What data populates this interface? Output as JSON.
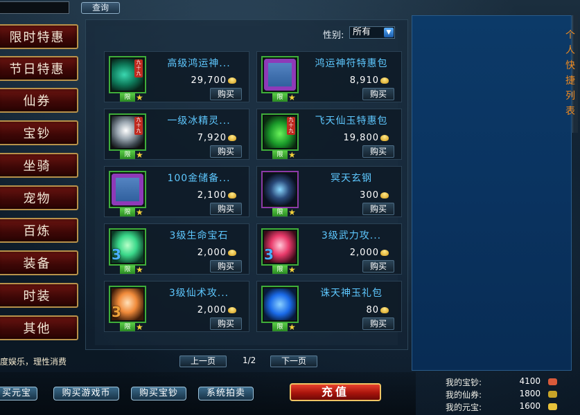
{
  "header": {
    "query_label": "查询"
  },
  "categories": [
    {
      "label": "限时特惠",
      "active": true
    },
    {
      "label": "节日特惠",
      "active": false
    },
    {
      "label": "仙券",
      "active": false
    },
    {
      "label": "宝钞",
      "active": false
    },
    {
      "label": "坐骑",
      "active": false
    },
    {
      "label": "宠物",
      "active": false
    },
    {
      "label": "百炼",
      "active": false
    },
    {
      "label": "装备",
      "active": false
    },
    {
      "label": "时装",
      "active": false
    },
    {
      "label": "其他",
      "active": false
    }
  ],
  "filter": {
    "gender_label": "性别:",
    "gender_value": "所有"
  },
  "items": [
    {
      "name": "高级鸿运神...",
      "price": "29,700",
      "buy": "购买",
      "limit": "限",
      "icon": "green-feather-icon",
      "tag": "九十九",
      "num": ""
    },
    {
      "name": "鸿运神符特惠包",
      "price": "8,910",
      "buy": "购买",
      "limit": "限",
      "icon": "gift-box-icon",
      "tag": "",
      "num": ""
    },
    {
      "name": "一级冰精灵...",
      "price": "7,920",
      "buy": "购买",
      "limit": "限",
      "icon": "silver-gem-icon",
      "tag": "九十九",
      "num": ""
    },
    {
      "name": "飞天仙玉特惠包",
      "price": "19,800",
      "buy": "购买",
      "limit": "限",
      "icon": "green-leaf-icon",
      "tag": "九十九",
      "num": ""
    },
    {
      "name": "100金储备...",
      "price": "2,100",
      "buy": "购买",
      "limit": "限",
      "icon": "gift-box-icon",
      "tag": "",
      "num": ""
    },
    {
      "name": "冥天玄钢",
      "price": "300",
      "buy": "购买",
      "limit": "限",
      "icon": "dark-ore-icon",
      "tag": "",
      "num": ""
    },
    {
      "name": "3级生命宝石",
      "price": "2,000",
      "buy": "购买",
      "limit": "限",
      "icon": "green-gem-icon",
      "tag": "",
      "num": "3"
    },
    {
      "name": "3级武力攻...",
      "price": "2,000",
      "buy": "购买",
      "limit": "限",
      "icon": "red-gem-icon",
      "tag": "",
      "num": "3"
    },
    {
      "name": "3级仙术攻...",
      "price": "2,000",
      "buy": "购买",
      "limit": "限",
      "icon": "orange-gem-icon",
      "tag": "",
      "num": "3"
    },
    {
      "name": "诛天神玉礼包",
      "price": "80",
      "buy": "购买",
      "limit": "限",
      "icon": "blue-jade-icon",
      "tag": "",
      "num": ""
    }
  ],
  "pagination": {
    "notice": "度娱乐，理性消费",
    "prev": "上一页",
    "page": "1/2",
    "next": "下一页"
  },
  "bottom": {
    "buy_yuanbao": "买元宝",
    "buy_game_coin": "购买游戏币",
    "buy_baochao": "购买宝钞",
    "auction": "系统拍卖",
    "recharge": "充值"
  },
  "sidebar": {
    "title": "个人快捷列表"
  },
  "balances": [
    {
      "label": "我的宝钞:",
      "value": "4100",
      "color": "#d85a3a"
    },
    {
      "label": "我的仙券:",
      "value": "1800",
      "color": "#c8a428"
    },
    {
      "label": "我的元宝:",
      "value": "1600",
      "color": "#e8c23a"
    }
  ]
}
